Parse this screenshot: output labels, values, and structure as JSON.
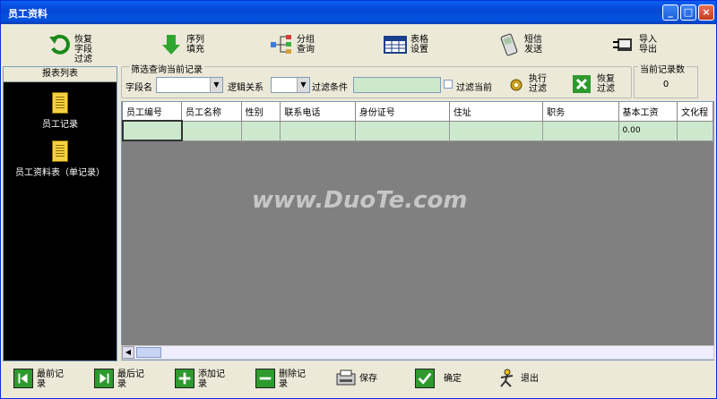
{
  "window": {
    "title": "员工资料"
  },
  "toolbar": [
    {
      "label": "恢复\n字段\n过滤",
      "icon": "undo-arrow-icon"
    },
    {
      "label": "序列\n填充",
      "icon": "down-arrow-icon"
    },
    {
      "label": "分组\n查询",
      "icon": "tree-icon"
    },
    {
      "label": "表格\n设置",
      "icon": "grid-icon"
    },
    {
      "label": "短信\n发送",
      "icon": "phone-icon"
    },
    {
      "label": "导入\n导出",
      "icon": "transfer-icon"
    }
  ],
  "sidebar": {
    "header": "报表列表",
    "items": [
      "员工记录",
      "员工资料表（单记录）"
    ]
  },
  "filter": {
    "legend": "筛选查询当前记录",
    "field_label": "字段名",
    "logic_label": "逻辑关系",
    "condition_label": "过滤条件",
    "filter_current_label": "过滤当前",
    "execute_label": "执行\n过滤",
    "restore_label": "恢复\n过滤"
  },
  "count": {
    "label": "当前记录数",
    "value": "0"
  },
  "table": {
    "columns": [
      "员工编号",
      "员工名称",
      "性别",
      "联系电话",
      "身份证号",
      "住址",
      "职务",
      "基本工资",
      "文化程"
    ],
    "row": [
      "",
      "",
      "",
      "",
      "",
      "",
      "",
      "0.00",
      ""
    ]
  },
  "bottom": [
    {
      "label": "最前记\n录",
      "icon": "first-record-icon"
    },
    {
      "label": "最后记\n录",
      "icon": "last-record-icon"
    },
    {
      "label": "添加记\n录",
      "icon": "add-icon"
    },
    {
      "label": "删除记\n录",
      "icon": "remove-icon"
    },
    {
      "label": "保存",
      "icon": "save-icon"
    },
    {
      "label": "确定",
      "icon": "check-icon"
    },
    {
      "label": "退出",
      "icon": "exit-icon"
    }
  ],
  "watermark": "www.DuoTe.com",
  "colors": {
    "title_bar": "#0546d6",
    "grid_row": "#cde9cd",
    "sidebar_bg": "#000000",
    "accent_green": "#2e9a2e"
  }
}
